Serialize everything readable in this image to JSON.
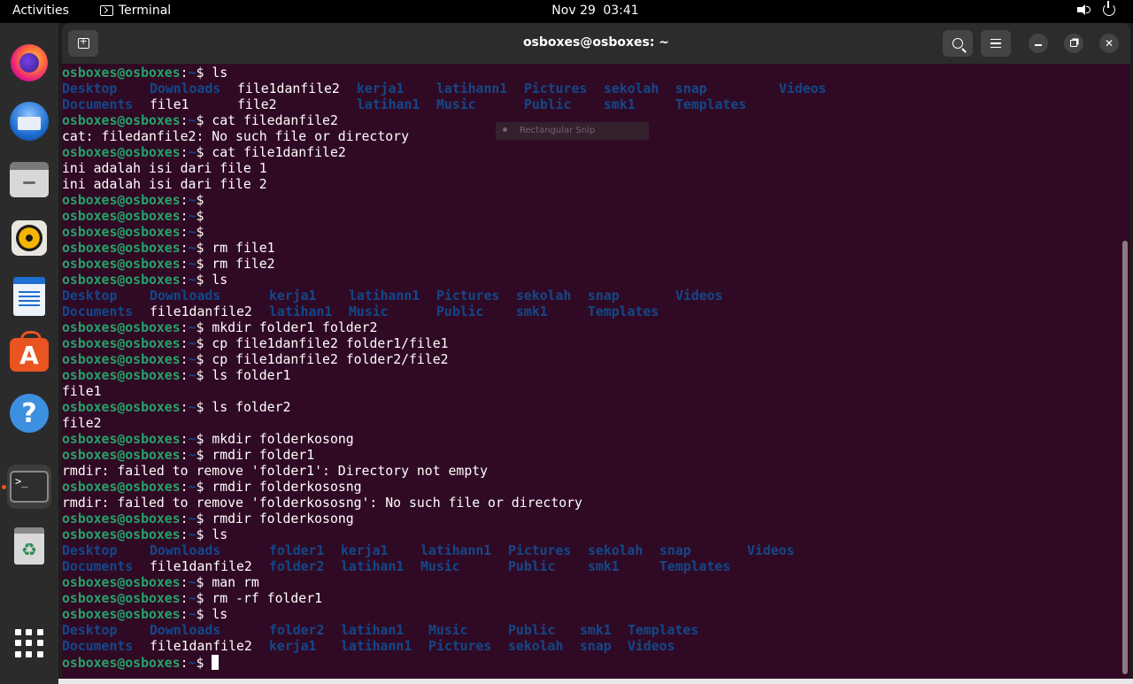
{
  "topbar": {
    "activities": "Activities",
    "app_name": "Terminal",
    "date": "Nov 29",
    "time": "03:41",
    "volume_icon": "speaker-icon",
    "power_icon": "power-icon"
  },
  "dock": {
    "items": [
      {
        "name": "firefox",
        "icon": "firefox-icon"
      },
      {
        "name": "thunderbird",
        "icon": "thunderbird-icon"
      },
      {
        "name": "files",
        "icon": "files-icon"
      },
      {
        "name": "rhythmbox",
        "icon": "rhythmbox-icon"
      },
      {
        "name": "writer",
        "icon": "writer-icon"
      },
      {
        "name": "app-center",
        "icon": "app-store-icon",
        "glyph": "A"
      },
      {
        "name": "help",
        "icon": "help-icon",
        "glyph": "?"
      },
      {
        "name": "terminal",
        "icon": "terminal-icon",
        "glyph": ">_"
      },
      {
        "name": "trash",
        "icon": "trash-icon",
        "glyph": "♻"
      },
      {
        "name": "show-apps",
        "icon": "app-grid-icon"
      }
    ],
    "active_color": "#e95420"
  },
  "window": {
    "title": "osboxes@osboxes: ~"
  },
  "snip": {
    "label": "Rectangular Snip"
  },
  "colors": {
    "background": "#300a24",
    "prompt_user": "#26a269",
    "directory": "#12488b",
    "text": "#ffffff"
  },
  "prompt": {
    "user": "osboxes@osboxes",
    "path": "~",
    "symbol": "$"
  },
  "terminal": {
    "lines": [
      {
        "type": "cmd",
        "text": "ls"
      },
      {
        "type": "ls",
        "cells": [
          [
            "Desktop",
            "d"
          ],
          [
            "Downloads",
            "d"
          ],
          [
            "file1danfile2",
            "f"
          ],
          [
            "kerja1",
            "d"
          ],
          [
            "latihann1",
            "d"
          ],
          [
            "Pictures",
            "d"
          ],
          [
            "sekolah",
            "d"
          ],
          [
            "snap",
            "d"
          ],
          [
            "Videos",
            "d"
          ]
        ],
        "cols": [
          0,
          11,
          22,
          37,
          47,
          58,
          68,
          77,
          90
        ]
      },
      {
        "type": "ls",
        "cells": [
          [
            "Documents",
            "d"
          ],
          [
            "file1",
            "f"
          ],
          [
            "file2",
            "f"
          ],
          [
            "latihan1",
            "d"
          ],
          [
            "Music",
            "d"
          ],
          [
            "Public",
            "d"
          ],
          [
            "smk1",
            "d"
          ],
          [
            "Templates",
            "d"
          ]
        ],
        "cols": [
          0,
          11,
          22,
          37,
          47,
          58,
          68,
          77
        ]
      },
      {
        "type": "cmd",
        "text": "cat filedanfile2"
      },
      {
        "type": "out",
        "text": "cat: filedanfile2: No such file or directory"
      },
      {
        "type": "cmd",
        "text": "cat file1danfile2"
      },
      {
        "type": "out",
        "text": "ini adalah isi dari file 1"
      },
      {
        "type": "out",
        "text": "ini adalah isi dari file 2"
      },
      {
        "type": "cmd",
        "text": ""
      },
      {
        "type": "cmd",
        "text": ""
      },
      {
        "type": "cmd",
        "text": ""
      },
      {
        "type": "cmd",
        "text": "rm file1"
      },
      {
        "type": "cmd",
        "text": "rm file2"
      },
      {
        "type": "cmd",
        "text": "ls"
      },
      {
        "type": "ls",
        "cells": [
          [
            "Desktop",
            "d"
          ],
          [
            "Downloads",
            "d"
          ],
          [
            "kerja1",
            "d"
          ],
          [
            "latihann1",
            "d"
          ],
          [
            "Pictures",
            "d"
          ],
          [
            "sekolah",
            "d"
          ],
          [
            "snap",
            "d"
          ],
          [
            "Videos",
            "d"
          ]
        ],
        "cols": [
          0,
          11,
          26,
          36,
          47,
          57,
          66,
          77
        ]
      },
      {
        "type": "ls",
        "cells": [
          [
            "Documents",
            "d"
          ],
          [
            "file1danfile2",
            "f"
          ],
          [
            "latihan1",
            "d"
          ],
          [
            "Music",
            "d"
          ],
          [
            "Public",
            "d"
          ],
          [
            "smk1",
            "d"
          ],
          [
            "Templates",
            "d"
          ]
        ],
        "cols": [
          0,
          11,
          26,
          36,
          47,
          57,
          66
        ]
      },
      {
        "type": "cmd",
        "text": "mkdir folder1 folder2"
      },
      {
        "type": "cmd",
        "text": "cp file1danfile2 folder1/file1"
      },
      {
        "type": "cmd",
        "text": "cp file1danfile2 folder2/file2"
      },
      {
        "type": "cmd",
        "text": "ls folder1"
      },
      {
        "type": "out",
        "text": "file1"
      },
      {
        "type": "cmd",
        "text": "ls folder2"
      },
      {
        "type": "out",
        "text": "file2"
      },
      {
        "type": "cmd",
        "text": "mkdir folderkosong"
      },
      {
        "type": "cmd",
        "text": "rmdir folder1"
      },
      {
        "type": "out",
        "text": "rmdir: failed to remove 'folder1': Directory not empty"
      },
      {
        "type": "cmd",
        "text": "rmdir folderkososng"
      },
      {
        "type": "out",
        "text": "rmdir: failed to remove 'folderkososng': No such file or directory"
      },
      {
        "type": "cmd",
        "text": "rmdir folderkosong"
      },
      {
        "type": "cmd",
        "text": "ls"
      },
      {
        "type": "ls",
        "cells": [
          [
            "Desktop",
            "d"
          ],
          [
            "Downloads",
            "d"
          ],
          [
            "folder1",
            "d"
          ],
          [
            "kerja1",
            "d"
          ],
          [
            "latihann1",
            "d"
          ],
          [
            "Pictures",
            "d"
          ],
          [
            "sekolah",
            "d"
          ],
          [
            "snap",
            "d"
          ],
          [
            "Videos",
            "d"
          ]
        ],
        "cols": [
          0,
          11,
          26,
          35,
          45,
          56,
          66,
          75,
          86
        ]
      },
      {
        "type": "ls",
        "cells": [
          [
            "Documents",
            "d"
          ],
          [
            "file1danfile2",
            "f"
          ],
          [
            "folder2",
            "d"
          ],
          [
            "latihan1",
            "d"
          ],
          [
            "Music",
            "d"
          ],
          [
            "Public",
            "d"
          ],
          [
            "smk1",
            "d"
          ],
          [
            "Templates",
            "d"
          ]
        ],
        "cols": [
          0,
          11,
          26,
          35,
          45,
          56,
          66,
          75
        ]
      },
      {
        "type": "cmd",
        "text": "man rm"
      },
      {
        "type": "cmd",
        "text": "rm -rf folder1"
      },
      {
        "type": "cmd",
        "text": "ls"
      },
      {
        "type": "ls",
        "cells": [
          [
            "Desktop",
            "d"
          ],
          [
            "Downloads",
            "d"
          ],
          [
            "folder2",
            "d"
          ],
          [
            "latihan1",
            "d"
          ],
          [
            "Music",
            "d"
          ],
          [
            "Public",
            "d"
          ],
          [
            "smk1",
            "d"
          ],
          [
            "Templates",
            "d"
          ]
        ],
        "cols": [
          0,
          11,
          26,
          35,
          46,
          56,
          65,
          71
        ]
      },
      {
        "type": "ls",
        "cells": [
          [
            "Documents",
            "d"
          ],
          [
            "file1danfile2",
            "f"
          ],
          [
            "kerja1",
            "d"
          ],
          [
            "latihann1",
            "d"
          ],
          [
            "Pictures",
            "d"
          ],
          [
            "sekolah",
            "d"
          ],
          [
            "snap",
            "d"
          ],
          [
            "Videos",
            "d"
          ]
        ],
        "cols": [
          0,
          11,
          26,
          35,
          46,
          56,
          65,
          71
        ]
      },
      {
        "type": "cmd",
        "text": "",
        "cursor": true
      }
    ]
  }
}
